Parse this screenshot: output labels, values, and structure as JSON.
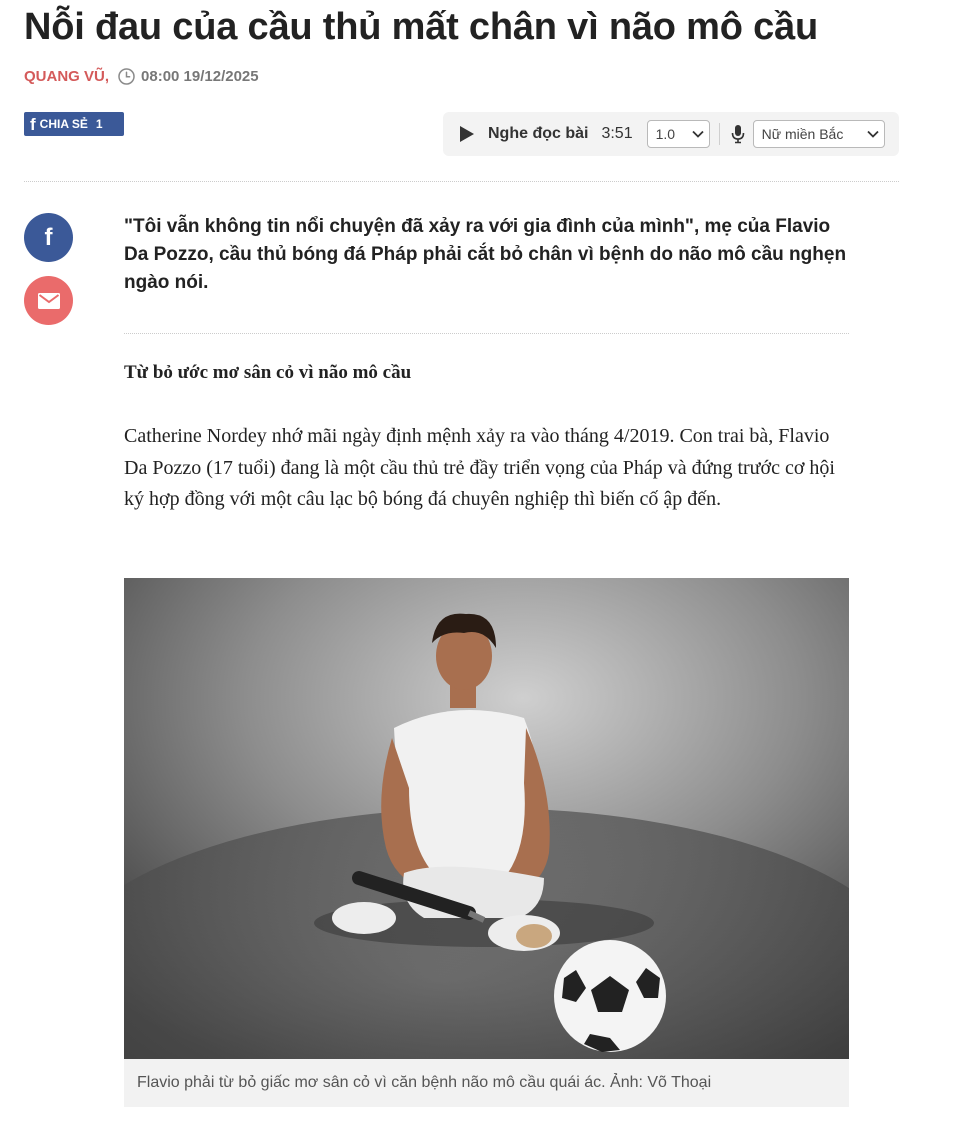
{
  "article": {
    "title": "Nỗi đau của cầu thủ mất chân vì não mô cầu",
    "author": "QUANG VŨ,",
    "published": "08:00 19/12/2025",
    "lead": "\"Tôi vẫn không tin nổi chuyện đã xảy ra với gia đình của mình\", mẹ của Flavio Da Pozzo, cầu thủ bóng đá Pháp phải cắt bỏ chân vì bệnh do não mô cầu nghẹn ngào nói.",
    "subheading": "Từ bỏ ước mơ sân cỏ vì não mô cầu",
    "paragraph": "Catherine Nordey nhớ mãi ngày định mệnh xảy ra vào tháng 4/2019. Con trai bà, Flavio Da Pozzo (17 tuổi) đang là một cầu thủ trẻ đầy triển vọng của Pháp và đứng trước cơ hội ký hợp đồng với một câu lạc bộ bóng đá chuyên nghiệp thì biến cố ập đến.",
    "image_caption": "Flavio phải từ bỏ giấc mơ sân cỏ vì căn bệnh não mô cầu quái ác. Ảnh: Võ Thoại"
  },
  "share": {
    "label": "CHIA SẺ",
    "count": "1"
  },
  "audio_player": {
    "label": "Nghe đọc bài",
    "duration": "3:51",
    "speed": "1.0",
    "voice": "Nữ miền Bắc"
  },
  "icons": {
    "clock": "clock-icon",
    "play": "play-icon",
    "mic": "microphone-icon",
    "facebook": "facebook-icon",
    "mail": "mail-icon"
  },
  "colors": {
    "author": "#d45a5a",
    "facebook": "#3b5998",
    "mail": "#ea6b6b",
    "player_bg": "#f3f3f3",
    "caption_bg": "#f2f2f2"
  }
}
